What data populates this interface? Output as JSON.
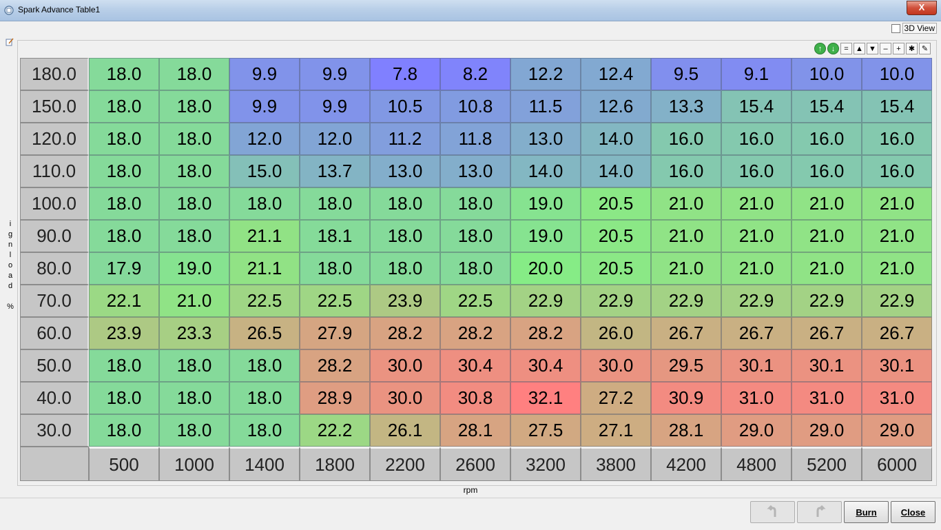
{
  "window": {
    "title": "Spark Advance Table1",
    "close_label": "X"
  },
  "options": {
    "view3d_label": "3D View",
    "view3d_checked": false
  },
  "axis": {
    "y_label": "ignload %",
    "x_label": "rpm"
  },
  "table": {
    "x_values": [
      "500",
      "1000",
      "1400",
      "1800",
      "2200",
      "2600",
      "3200",
      "3800",
      "4200",
      "4800",
      "5200",
      "6000"
    ],
    "y_values": [
      "180.0",
      "150.0",
      "120.0",
      "110.0",
      "100.0",
      "90.0",
      "80.0",
      "70.0",
      "60.0",
      "50.0",
      "40.0",
      "30.0"
    ],
    "rows": [
      [
        "18.0",
        "18.0",
        "9.9",
        "9.9",
        "7.8",
        "8.2",
        "12.2",
        "12.4",
        "9.5",
        "9.1",
        "10.0",
        "10.0"
      ],
      [
        "18.0",
        "18.0",
        "9.9",
        "9.9",
        "10.5",
        "10.8",
        "11.5",
        "12.6",
        "13.3",
        "15.4",
        "15.4",
        "15.4"
      ],
      [
        "18.0",
        "18.0",
        "12.0",
        "12.0",
        "11.2",
        "11.8",
        "13.0",
        "14.0",
        "16.0",
        "16.0",
        "16.0",
        "16.0"
      ],
      [
        "18.0",
        "18.0",
        "15.0",
        "13.7",
        "13.0",
        "13.0",
        "14.0",
        "14.0",
        "16.0",
        "16.0",
        "16.0",
        "16.0"
      ],
      [
        "18.0",
        "18.0",
        "18.0",
        "18.0",
        "18.0",
        "18.0",
        "19.0",
        "20.5",
        "21.0",
        "21.0",
        "21.0",
        "21.0"
      ],
      [
        "18.0",
        "18.0",
        "21.1",
        "18.1",
        "18.0",
        "18.0",
        "19.0",
        "20.5",
        "21.0",
        "21.0",
        "21.0",
        "21.0"
      ],
      [
        "17.9",
        "19.0",
        "21.1",
        "18.0",
        "18.0",
        "18.0",
        "20.0",
        "20.5",
        "21.0",
        "21.0",
        "21.0",
        "21.0"
      ],
      [
        "22.1",
        "21.0",
        "22.5",
        "22.5",
        "23.9",
        "22.5",
        "22.9",
        "22.9",
        "22.9",
        "22.9",
        "22.9",
        "22.9"
      ],
      [
        "23.9",
        "23.3",
        "26.5",
        "27.9",
        "28.2",
        "28.2",
        "28.2",
        "26.0",
        "26.7",
        "26.7",
        "26.7",
        "26.7"
      ],
      [
        "18.0",
        "18.0",
        "18.0",
        "28.2",
        "30.0",
        "30.4",
        "30.4",
        "30.0",
        "29.5",
        "30.1",
        "30.1",
        "30.1"
      ],
      [
        "18.0",
        "18.0",
        "18.0",
        "28.9",
        "30.0",
        "30.8",
        "32.1",
        "27.2",
        "30.9",
        "31.0",
        "31.0",
        "31.0"
      ],
      [
        "18.0",
        "18.0",
        "18.0",
        "22.2",
        "26.1",
        "28.1",
        "27.5",
        "27.1",
        "28.1",
        "29.0",
        "29.0",
        "29.0"
      ]
    ]
  },
  "toolbar": {
    "buttons": [
      {
        "name": "increase-icon",
        "glyph": "↑",
        "round": true
      },
      {
        "name": "decrease-icon",
        "glyph": "↓",
        "round": true
      },
      {
        "name": "equals-icon",
        "glyph": "=",
        "round": false
      },
      {
        "name": "triangle-up-icon",
        "glyph": "▲",
        "round": false
      },
      {
        "name": "triangle-down-icon",
        "glyph": "▼",
        "round": false
      },
      {
        "name": "minus-icon",
        "glyph": "–",
        "round": false
      },
      {
        "name": "plus-icon",
        "glyph": "+",
        "round": false
      },
      {
        "name": "multiply-icon",
        "glyph": "✱",
        "round": false
      },
      {
        "name": "pencil-icon",
        "glyph": "✎",
        "round": false
      }
    ]
  },
  "buttons": {
    "burn_label": "Burn",
    "close_label": "Close"
  },
  "colors": {
    "low": "#8080ff",
    "mid": "#86ec86",
    "high": "#ff8080",
    "range_min": 7.8,
    "range_mid": 20.0,
    "range_max": 32.1
  }
}
